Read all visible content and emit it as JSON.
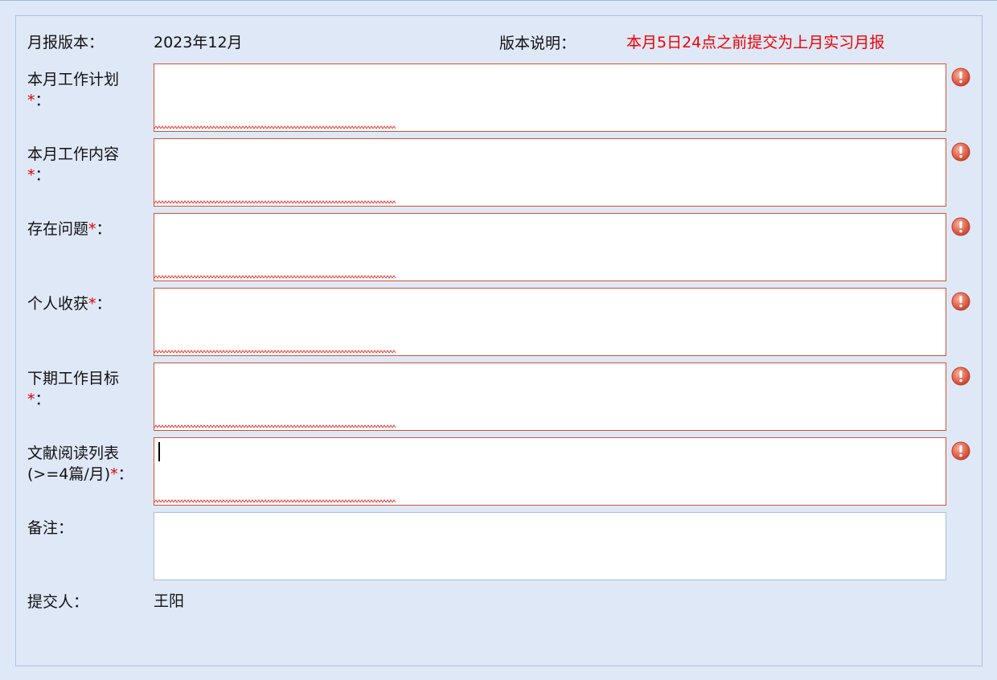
{
  "header": {
    "version_label": "月报版本：",
    "version_value": "2023年12月",
    "desc_label": "版本说明：",
    "desc_value": "本月5日24点之前提交为上月实习月报"
  },
  "fields": [
    {
      "label_main": "本月工作计划",
      "label_req": "*",
      "label_colon": "：",
      "value": "",
      "required": true,
      "error_icon": "error-exclamation-icon"
    },
    {
      "label_main": "本月工作内容",
      "label_req": "*",
      "label_colon": "：",
      "value": "",
      "required": true,
      "error_icon": "error-exclamation-icon"
    },
    {
      "label_main": "存在问题",
      "label_req": "*",
      "label_colon": "：",
      "value": "",
      "required": true,
      "error_icon": "error-exclamation-icon"
    },
    {
      "label_main": "个人收获",
      "label_req": "*",
      "label_colon": "：",
      "value": "",
      "required": true,
      "error_icon": "error-exclamation-icon"
    },
    {
      "label_main": "下期工作目标",
      "label_req": "*",
      "label_colon": "：",
      "value": "",
      "required": true,
      "error_icon": "error-exclamation-icon"
    },
    {
      "label_main": "文献阅读列表",
      "label_main2": "(>=4篇/月)",
      "label_req": "*",
      "label_colon": "：",
      "value": "",
      "required": true,
      "focused": true,
      "error_icon": "error-exclamation-icon"
    },
    {
      "label_main": "备注",
      "label_colon": "：",
      "value": "",
      "required": false
    }
  ],
  "submitter": {
    "label": "提交人：",
    "value": "王阳"
  },
  "colors": {
    "background": "#dfe8f6",
    "panel_border": "#a9c1e6",
    "required_mark": "#e00000",
    "notice_text": "#ee0000",
    "invalid_border": "#cc5533",
    "valid_border": "#a9bfd6",
    "error_icon": "#e8705a"
  }
}
